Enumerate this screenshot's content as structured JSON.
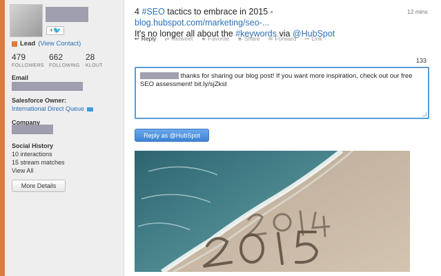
{
  "profile": {
    "follow_button": "+",
    "lead_label": "Lead",
    "view_contact_link": "(View Contact)",
    "stats": [
      {
        "value": "479",
        "label": "FOLLOWERS"
      },
      {
        "value": "662",
        "label": "FOLLOWING"
      },
      {
        "value": "28",
        "label": "KLOUT"
      }
    ],
    "email_title": "Email",
    "owner_title": "Salesforce Owner:",
    "owner_value": "International Direct Queue",
    "company_title": "Company",
    "social_history_title": "Social History",
    "interactions": "10 interactions",
    "stream_matches": "15 stream matches",
    "view_all_link": "View All",
    "more_details_button": "More Details"
  },
  "tweet": {
    "part1": "4 ",
    "tag1": "#SEO",
    "part2": " tactics to embrace in 2015 - ",
    "link": "blog.hubspot.com/marketing/seo-...",
    "part3": "It's no longer all about the ",
    "tag2": "#keywords",
    "part4": " via ",
    "mention": "@HubSpot",
    "time": "12 mins"
  },
  "actions": {
    "reply": "Reply",
    "retweet": "Retweet",
    "favorite": "Favorite",
    "share": "Share",
    "forward": "Forward",
    "link": "Link"
  },
  "reply": {
    "char_count": "133",
    "text": " thanks for sharing our blog post! If you want more inspiration, check out our free SEO assessment! bit.ly/sjZkst",
    "button": "Reply as @HubSpot"
  },
  "colors": {
    "accent": "#e07a3a",
    "link": "#2a6fb6",
    "button": "#3f83d4"
  }
}
